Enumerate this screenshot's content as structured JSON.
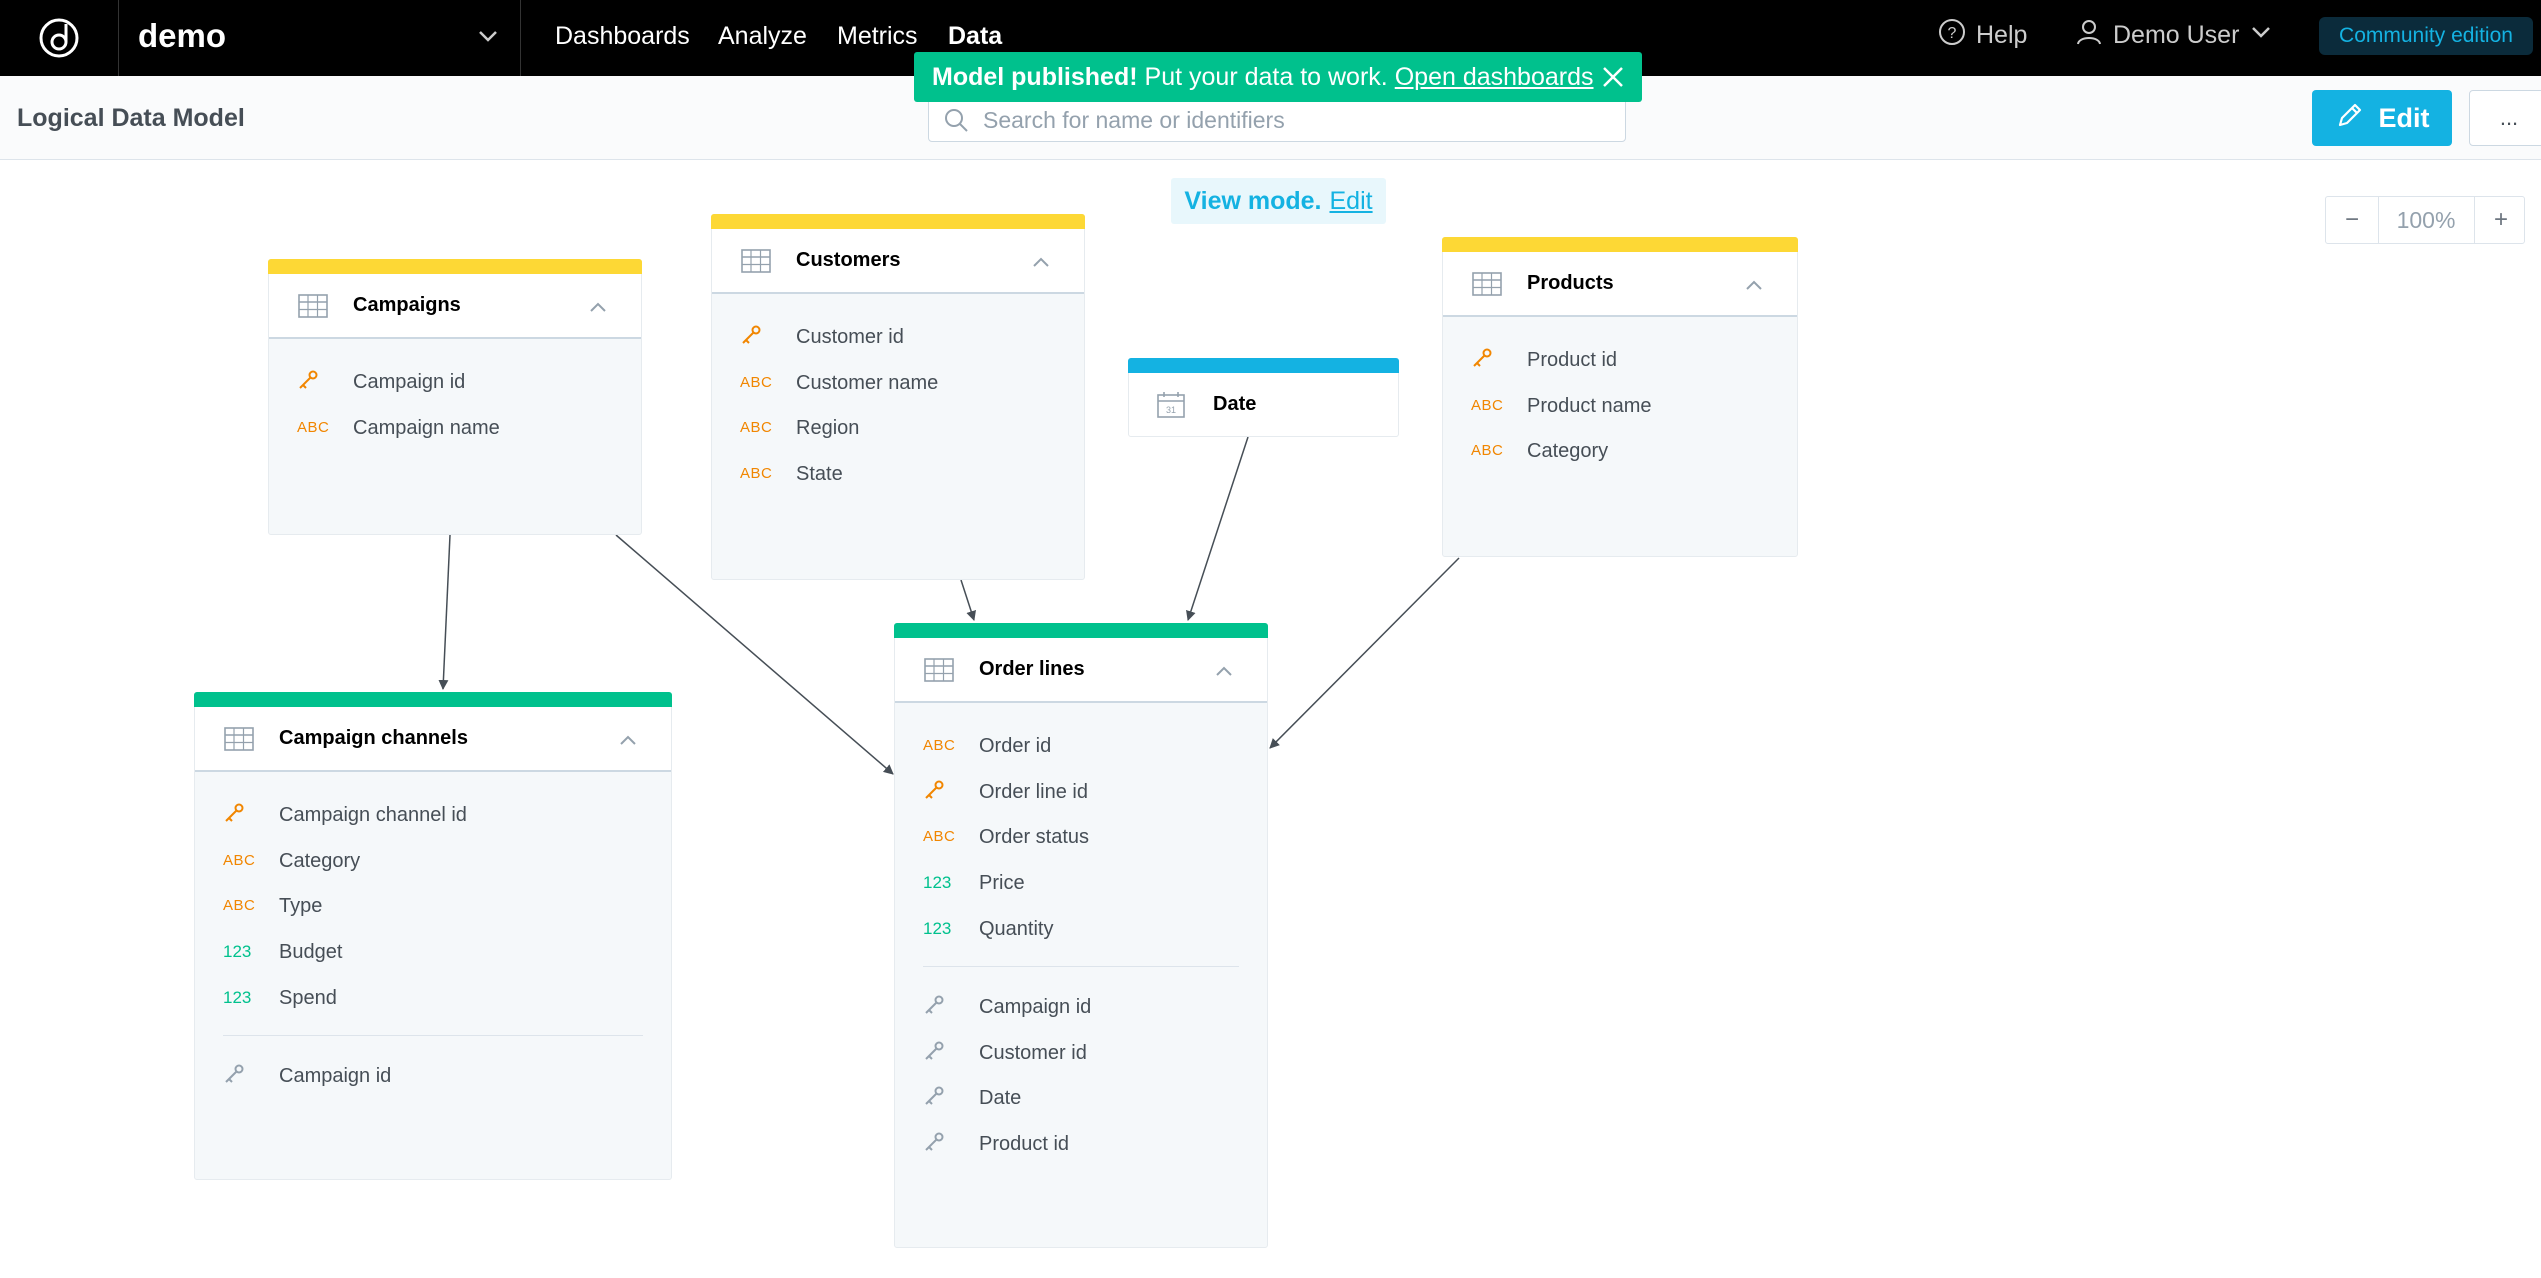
{
  "topbar": {
    "workspace": "demo",
    "nav": [
      "Dashboards",
      "Analyze",
      "Metrics",
      "Data"
    ],
    "active_nav": "Data",
    "help": "Help",
    "user": "Demo User",
    "edition": "Community edition"
  },
  "header": {
    "title": "Logical Data Model",
    "search_placeholder": "Search for name or identifiers",
    "edit_button": "Edit",
    "more_button": "..."
  },
  "toast": {
    "strong": "Model published!",
    "text": "Put your data to work.",
    "link": "Open dashboards"
  },
  "view_mode": {
    "label": "View mode.",
    "link": "Edit"
  },
  "zoom": {
    "minus": "−",
    "value": "100%",
    "plus": "+"
  },
  "colors": {
    "dataset_bar": "#fdd835",
    "fact_bar": "#00c18d",
    "date_bar": "#14b2e2",
    "accent": "#14b2e2",
    "toast": "#00c18d"
  },
  "datasets": {
    "campaigns": {
      "name": "Campaigns",
      "fields": [
        {
          "icon": "key-icon",
          "label": "Campaign id"
        },
        {
          "icon": "ABC",
          "label": "Campaign name"
        }
      ]
    },
    "customers": {
      "name": "Customers",
      "fields": [
        {
          "icon": "key-icon",
          "label": "Customer id"
        },
        {
          "icon": "ABC",
          "label": "Customer name"
        },
        {
          "icon": "ABC",
          "label": "Region"
        },
        {
          "icon": "ABC",
          "label": "State"
        }
      ]
    },
    "date": {
      "name": "Date"
    },
    "products": {
      "name": "Products",
      "fields": [
        {
          "icon": "key-icon",
          "label": "Product id"
        },
        {
          "icon": "ABC",
          "label": "Product name"
        },
        {
          "icon": "ABC",
          "label": "Category"
        }
      ]
    },
    "campaign_channels": {
      "name": "Campaign channels",
      "fields": [
        {
          "icon": "key-icon",
          "label": "Campaign channel id"
        },
        {
          "icon": "ABC",
          "label": "Category"
        },
        {
          "icon": "ABC",
          "label": "Type"
        },
        {
          "icon": "123",
          "label": "Budget"
        },
        {
          "icon": "123",
          "label": "Spend"
        }
      ],
      "references": [
        {
          "icon": "reference-key-icon",
          "label": "Campaign id"
        }
      ]
    },
    "order_lines": {
      "name": "Order lines",
      "fields": [
        {
          "icon": "ABC",
          "label": "Order id"
        },
        {
          "icon": "key-icon",
          "label": "Order line id"
        },
        {
          "icon": "ABC",
          "label": "Order status"
        },
        {
          "icon": "123",
          "label": "Price"
        },
        {
          "icon": "123",
          "label": "Quantity"
        }
      ],
      "references": [
        {
          "icon": "reference-key-icon",
          "label": "Campaign id"
        },
        {
          "icon": "reference-key-icon",
          "label": "Customer id"
        },
        {
          "icon": "reference-key-icon",
          "label": "Date"
        },
        {
          "icon": "reference-key-icon",
          "label": "Product id"
        }
      ]
    }
  }
}
